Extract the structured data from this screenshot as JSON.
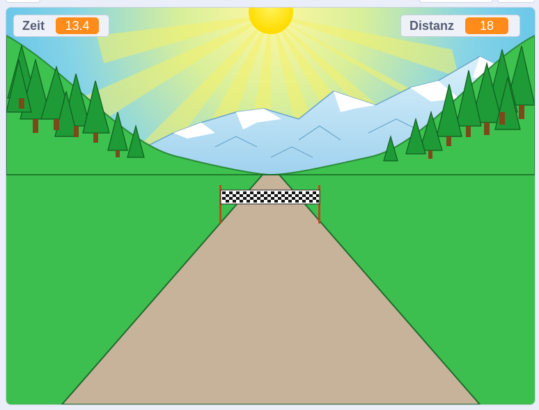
{
  "monitors": {
    "zeit": {
      "label": "Zeit",
      "value": "13.4"
    },
    "distanz": {
      "label": "Distanz",
      "value": "18"
    }
  },
  "colors": {
    "monitor_value_bg": "#ff8c1a",
    "monitor_label": "#575e75",
    "grass": "#3dbf4f",
    "road": "#c6b39a",
    "sun": "#ffe21a",
    "sky": "#49b8ee"
  },
  "scene_icons": [
    "sun-icon",
    "mountains-icon",
    "trees-icon",
    "road-icon",
    "finish-line-banner-icon"
  ]
}
